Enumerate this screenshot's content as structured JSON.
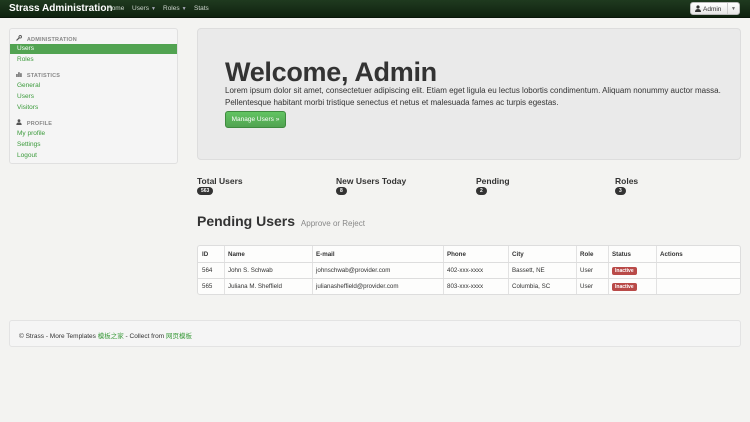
{
  "navbar": {
    "brand": "Strass Administration",
    "items": [
      {
        "label": "Home"
      },
      {
        "label": "Users"
      },
      {
        "label": "Roles"
      },
      {
        "label": "Stats"
      }
    ],
    "user_button": {
      "label": "Admin"
    }
  },
  "sidebar": {
    "sections": [
      {
        "header": "ADMINISTRATION",
        "icon": "wrench-icon",
        "items": [
          "Users",
          "Roles"
        ]
      },
      {
        "header": "STATISTICS",
        "icon": "bar-chart-icon",
        "items": [
          "General",
          "Users",
          "Visitors"
        ]
      },
      {
        "header": "PROFILE",
        "icon": "user-icon",
        "items": [
          "My profile",
          "Settings",
          "Logout"
        ]
      }
    ],
    "active_item": "Users"
  },
  "hero": {
    "title": "Welcome, Admin",
    "text": "Lorem ipsum dolor sit amet, consectetuer adipiscing elit. Etiam eget ligula eu lectus lobortis condimentum. Aliquam nonummy auctor massa. Pellentesque habitant morbi tristique senectus et netus et malesuada fames ac turpis egestas.",
    "button": "Manage Users »"
  },
  "stats": [
    {
      "label": "Total Users",
      "value": "563"
    },
    {
      "label": "New Users Today",
      "value": "8"
    },
    {
      "label": "Pending",
      "value": "2"
    },
    {
      "label": "Roles",
      "value": "3"
    }
  ],
  "pending": {
    "title": "Pending Users",
    "subtitle": "Approve or Reject",
    "columns": [
      "ID",
      "Name",
      "E-mail",
      "Phone",
      "City",
      "Role",
      "Status",
      "Actions"
    ],
    "rows": [
      [
        "564",
        "John S. Schwab",
        "johnschwab@provider.com",
        "402-xxx-xxxx",
        "Bassett, NE",
        "User",
        "Inactive",
        ""
      ],
      [
        "565",
        "Juliana M. Sheffield",
        "julianasheffield@provider.com",
        "803-xxx-xxxx",
        "Columbia, SC",
        "User",
        "Inactive",
        ""
      ]
    ]
  },
  "footer": {
    "prefix": "© Strass - More Templates ",
    "link1": "模板之家",
    "middle": " - Collect from ",
    "link2": "网页模板"
  },
  "colors": {
    "navbar": "#1a331a",
    "accent": "#51a351",
    "link": "#3a9a3a",
    "badge_inactive": "#b94a48"
  }
}
